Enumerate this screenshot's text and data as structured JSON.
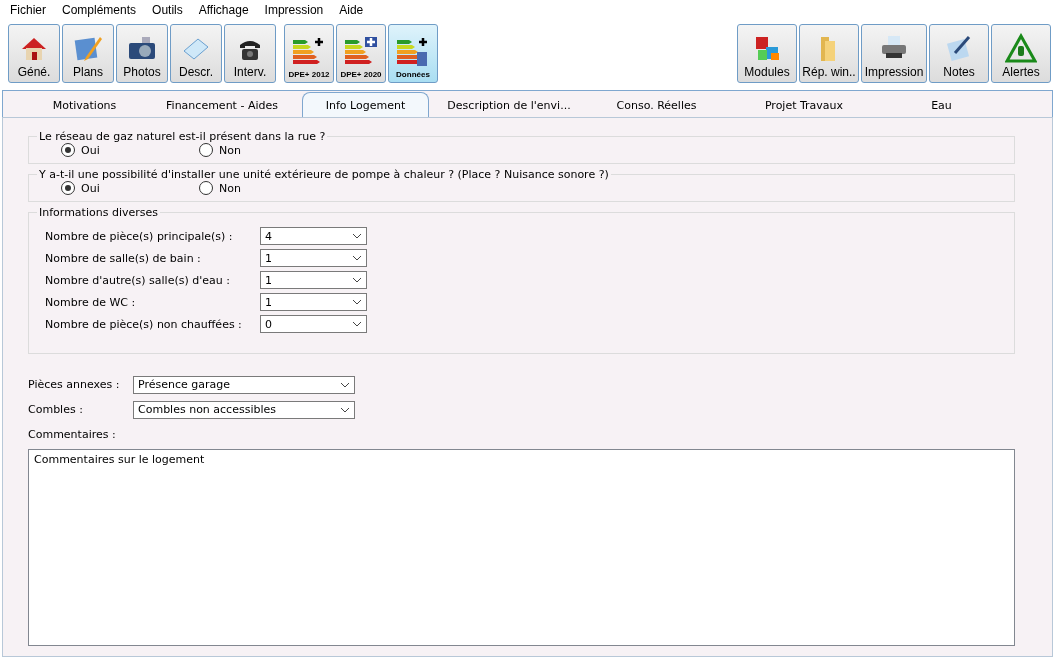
{
  "menu": [
    "Fichier",
    "Compléments",
    "Outils",
    "Affichage",
    "Impression",
    "Aide"
  ],
  "toolbar_left": [
    {
      "label": "Géné.",
      "selected": false
    },
    {
      "label": "Plans",
      "selected": false
    },
    {
      "label": "Photos",
      "selected": false
    },
    {
      "label": "Descr.",
      "selected": false
    },
    {
      "label": "Interv.",
      "selected": false
    }
  ],
  "toolbar_dpe": [
    {
      "label": "DPE+ 2012",
      "selected": false
    },
    {
      "label": "DPE+ 2020",
      "selected": false
    },
    {
      "label": "Données",
      "selected": true
    }
  ],
  "toolbar_right": [
    {
      "label": "Modules",
      "selected": false
    },
    {
      "label": "Rép. win..",
      "selected": false
    },
    {
      "label": "Impression",
      "selected": false
    },
    {
      "label": "Notes",
      "selected": false
    },
    {
      "label": "Alertes",
      "selected": false
    }
  ],
  "tabs": [
    {
      "label": "Motivations",
      "selected": false
    },
    {
      "label": "Financement  - Aides",
      "selected": false
    },
    {
      "label": "Info Logement",
      "selected": true
    },
    {
      "label": "Description de l'envi...",
      "selected": false
    },
    {
      "label": "Conso. Réelles",
      "selected": false
    },
    {
      "label": "Projet Travaux",
      "selected": false
    },
    {
      "label": "Eau",
      "selected": false
    }
  ],
  "questions": [
    {
      "legend": "Le réseau de gaz naturel est-il présent dans la rue ?",
      "options": [
        {
          "label": "Oui",
          "selected": true
        },
        {
          "label": "Non",
          "selected": false
        }
      ]
    },
    {
      "legend": "Y a-t-il une possibilité d'installer une unité extérieure de pompe à chaleur ? (Place ? Nuisance sonore ?)",
      "options": [
        {
          "label": "Oui",
          "selected": true
        },
        {
          "label": "Non",
          "selected": false
        }
      ]
    }
  ],
  "informations": {
    "legend": "Informations diverses",
    "fields": [
      {
        "label": "Nombre de pièce(s) principale(s) :",
        "value": "4"
      },
      {
        "label": "Nombre de salle(s) de bain :",
        "value": "1"
      },
      {
        "label": "Nombre d'autre(s) salle(s) d'eau :",
        "value": "1"
      },
      {
        "label": "Nombre de WC :",
        "value": "1"
      },
      {
        "label": "Nombre de pièce(s) non chauffées :",
        "value": "0"
      }
    ]
  },
  "annexes": [
    {
      "label": "Pièces annexes :",
      "value": "Présence garage"
    },
    {
      "label": "Combles :",
      "value": "Combles non accessibles"
    }
  ],
  "comments": {
    "label": "Commentaires :",
    "value": "Commentaires sur le logement"
  }
}
